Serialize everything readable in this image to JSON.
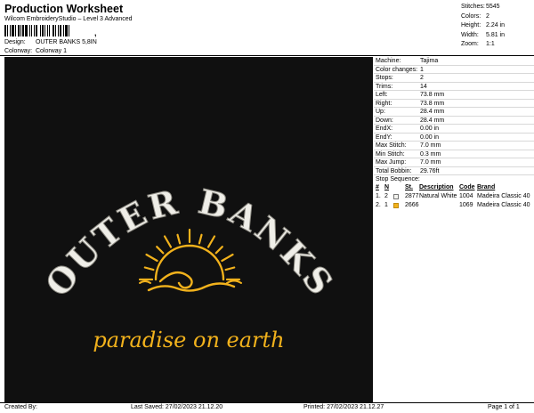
{
  "header": {
    "title": "Production Worksheet",
    "software": "Wilcom EmbroideryStudio – Level 3 Advanced",
    "barcode_text": ",",
    "design_label": "Design:",
    "design_value": "OUTER BANKS 5,8IN",
    "colorway_label": "Colorway:",
    "colorway_value": "Colorway 1"
  },
  "summary": [
    {
      "label": "Stitches:",
      "value": "5545"
    },
    {
      "label": "Colors:",
      "value": "2"
    },
    {
      "label": "Height:",
      "value": "2.24 in"
    },
    {
      "label": "Width:",
      "value": "5.81 in"
    },
    {
      "label": "Zoom:",
      "value": "1:1"
    }
  ],
  "design_art": {
    "top_text": "OUTER BANKS",
    "script_text": "paradise on earth",
    "white_thread": "#efeee8",
    "gold_thread": "#f2b21c",
    "background": "#101010"
  },
  "specs": [
    {
      "label": "Machine:",
      "value": "Tajima"
    },
    {
      "label": "Color changes:",
      "value": "1"
    },
    {
      "label": "Stops:",
      "value": "2"
    },
    {
      "label": "Trims:",
      "value": "14"
    },
    {
      "label": "Left:",
      "value": "73.8 mm"
    },
    {
      "label": "Right:",
      "value": "73.8 mm"
    },
    {
      "label": "Up:",
      "value": "28.4 mm"
    },
    {
      "label": "Down:",
      "value": "28.4 mm"
    },
    {
      "label": "EndX:",
      "value": "0.00 in"
    },
    {
      "label": "EndY:",
      "value": "0.00 in"
    },
    {
      "label": "Max Stitch:",
      "value": "7.0 mm"
    },
    {
      "label": "Min Stitch:",
      "value": "0.3 mm"
    },
    {
      "label": "Max Jump:",
      "value": "7.0 mm"
    },
    {
      "label": "Total Bobbin:",
      "value": "29.76ft"
    }
  ],
  "stop_sequence": {
    "title": "Stop Sequence:",
    "headers": {
      "num": "#",
      "n": "N",
      "st": "St.",
      "description": "Description",
      "code": "Code",
      "brand": "Brand"
    },
    "rows": [
      {
        "num": "1.",
        "n": "2",
        "color": "#f4f4f0",
        "st": "2877",
        "description": "Natural White",
        "code": "1004",
        "brand": "Madeira Classic 40"
      },
      {
        "num": "2.",
        "n": "1",
        "color": "#f2b21c",
        "st": "2666",
        "description": "",
        "code": "1069",
        "brand": "Madeira Classic 40"
      }
    ]
  },
  "footer": {
    "created_by": "Created By:",
    "last_saved": "Last Saved: 27/02/2023 21.12.20",
    "printed": "Printed: 27/02/2023 21.12.27",
    "page": "Page 1 of 1"
  }
}
